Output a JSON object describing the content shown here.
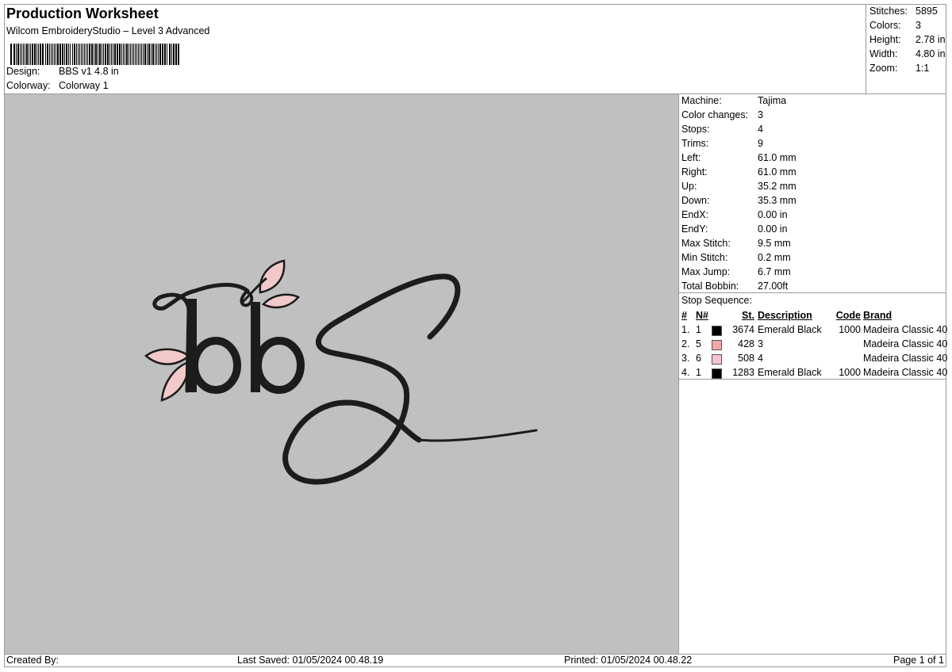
{
  "header": {
    "title": "Production Worksheet",
    "subtitle": "Wilcom EmbroideryStudio – Level 3 Advanced",
    "design_label": "Design:",
    "design_value": "BBS v1 4.8 in",
    "colorway_label": "Colorway:",
    "colorway_value": "Colorway 1"
  },
  "summary": {
    "stitches_label": "Stitches:",
    "stitches_value": "5895",
    "colors_label": "Colors:",
    "colors_value": "3",
    "height_label": "Height:",
    "height_value": "2.78 in",
    "width_label": "Width:",
    "width_value": "4.80 in",
    "zoom_label": "Zoom:",
    "zoom_value": "1:1"
  },
  "specs": [
    {
      "label": "Machine:",
      "value": "Tajima"
    },
    {
      "label": "Color changes:",
      "value": "3"
    },
    {
      "label": "Stops:",
      "value": "4"
    },
    {
      "label": "Trims:",
      "value": "9"
    },
    {
      "label": "Left:",
      "value": "61.0 mm"
    },
    {
      "label": "Right:",
      "value": "61.0 mm"
    },
    {
      "label": "Up:",
      "value": "35.2 mm"
    },
    {
      "label": "Down:",
      "value": "35.3 mm"
    },
    {
      "label": "EndX:",
      "value": "0.00 in"
    },
    {
      "label": "EndY:",
      "value": "0.00 in"
    },
    {
      "label": "Max Stitch:",
      "value": "9.5 mm"
    },
    {
      "label": "Min Stitch:",
      "value": "0.2 mm"
    },
    {
      "label": "Max Jump:",
      "value": "6.7 mm"
    },
    {
      "label": "Total Bobbin:",
      "value": "27.00ft"
    }
  ],
  "stop_sequence": {
    "title": "Stop Sequence:",
    "headers": {
      "num": "#",
      "n": "N#",
      "st": "St.",
      "description": "Description",
      "code": "Code",
      "brand": "Brand"
    },
    "rows": [
      {
        "num": "1.",
        "n": "1",
        "color": "#000000",
        "st": "3674",
        "description": "Emerald Black",
        "code": "1000",
        "brand": "Madeira Classic 40"
      },
      {
        "num": "2.",
        "n": "5",
        "color": "#f4a6a8",
        "st": "428",
        "description": "3",
        "code": "",
        "brand": "Madeira Classic 40"
      },
      {
        "num": "3.",
        "n": "6",
        "color": "#f5c2d2",
        "st": "508",
        "description": "4",
        "code": "",
        "brand": "Madeira Classic 40"
      },
      {
        "num": "4.",
        "n": "1",
        "color": "#000000",
        "st": "1283",
        "description": "Emerald Black",
        "code": "1000",
        "brand": "Madeira Classic 40"
      }
    ]
  },
  "footer": {
    "created_by": "Created By:",
    "last_saved": "Last Saved: 01/05/2024 00.48.19",
    "printed": "Printed: 01/05/2024 00.48.22",
    "page": "Page 1 of 1"
  },
  "preview": {
    "background": "#c0c0c0",
    "thread_dark": "#1c1c1c",
    "leaf_pink": "#f2c9c9"
  }
}
